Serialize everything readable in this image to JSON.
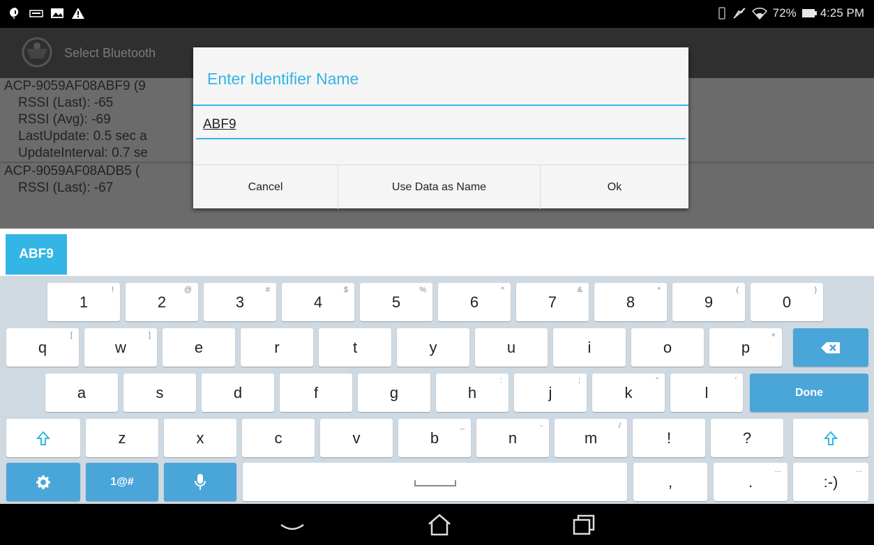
{
  "status_bar": {
    "left_icons": [
      "chat-bubble-icon",
      "keyboard-icon",
      "image-icon",
      "warning-icon"
    ],
    "battery": "72%",
    "time": "4:25 PM"
  },
  "action_bar": {
    "title": "Select Bluetooth"
  },
  "device_list": [
    {
      "name": "ACP-9059AF08ABF9 (9",
      "lines": [
        "RSSI (Last): -65",
        "RSSI (Avg): -69",
        "LastUpdate: 0.5 sec a",
        "UpdateInterval: 0.7 se"
      ]
    },
    {
      "name": "ACP-9059AF08ADB5 (",
      "lines": [
        "RSSI (Last): -67"
      ]
    }
  ],
  "dialog": {
    "title": "Enter Identifier Name",
    "input_value": "ABF9",
    "buttons": {
      "cancel": "Cancel",
      "use_data": "Use Data as Name",
      "ok": "Ok"
    }
  },
  "suggestion": "ABF9",
  "keyboard": {
    "row1": [
      {
        "k": "1",
        "s": "!"
      },
      {
        "k": "2",
        "s": "@"
      },
      {
        "k": "3",
        "s": "#"
      },
      {
        "k": "4",
        "s": "$"
      },
      {
        "k": "5",
        "s": "%"
      },
      {
        "k": "6",
        "s": "^"
      },
      {
        "k": "7",
        "s": "&"
      },
      {
        "k": "8",
        "s": "*"
      },
      {
        "k": "9",
        "s": "("
      },
      {
        "k": "0",
        "s": ")"
      }
    ],
    "row2": [
      {
        "k": "q",
        "s": "["
      },
      {
        "k": "w",
        "s": "]"
      },
      {
        "k": "e",
        "s": ""
      },
      {
        "k": "r",
        "s": ""
      },
      {
        "k": "t",
        "s": ""
      },
      {
        "k": "y",
        "s": ""
      },
      {
        "k": "u",
        "s": ""
      },
      {
        "k": "i",
        "s": ""
      },
      {
        "k": "o",
        "s": ""
      },
      {
        "k": "p",
        "s": "+"
      }
    ],
    "row3": [
      {
        "k": "a",
        "s": ""
      },
      {
        "k": "s",
        "s": ""
      },
      {
        "k": "d",
        "s": ""
      },
      {
        "k": "f",
        "s": ""
      },
      {
        "k": "g",
        "s": ""
      },
      {
        "k": "h",
        "s": ":"
      },
      {
        "k": "j",
        "s": ";"
      },
      {
        "k": "k",
        "s": "\""
      },
      {
        "k": "l",
        "s": "'"
      }
    ],
    "row4": [
      {
        "k": "z",
        "s": ""
      },
      {
        "k": "x",
        "s": ""
      },
      {
        "k": "c",
        "s": ""
      },
      {
        "k": "v",
        "s": ""
      },
      {
        "k": "b",
        "s": "_"
      },
      {
        "k": "n",
        "s": "-"
      },
      {
        "k": "m",
        "s": "/"
      },
      {
        "k": "!",
        "s": ""
      },
      {
        "k": "?",
        "s": ""
      }
    ],
    "done": "Done",
    "symbols": "1@#",
    "comma": ",",
    "period": ".",
    "period_sup": "...",
    "smiley": ":-)",
    "smiley_sup": "...",
    "space_icon": "space-bar-icon"
  },
  "colors": {
    "accent": "#33b5e5",
    "key_blue": "#4aa6d9",
    "keyboard_bg": "#cfd9e2"
  }
}
